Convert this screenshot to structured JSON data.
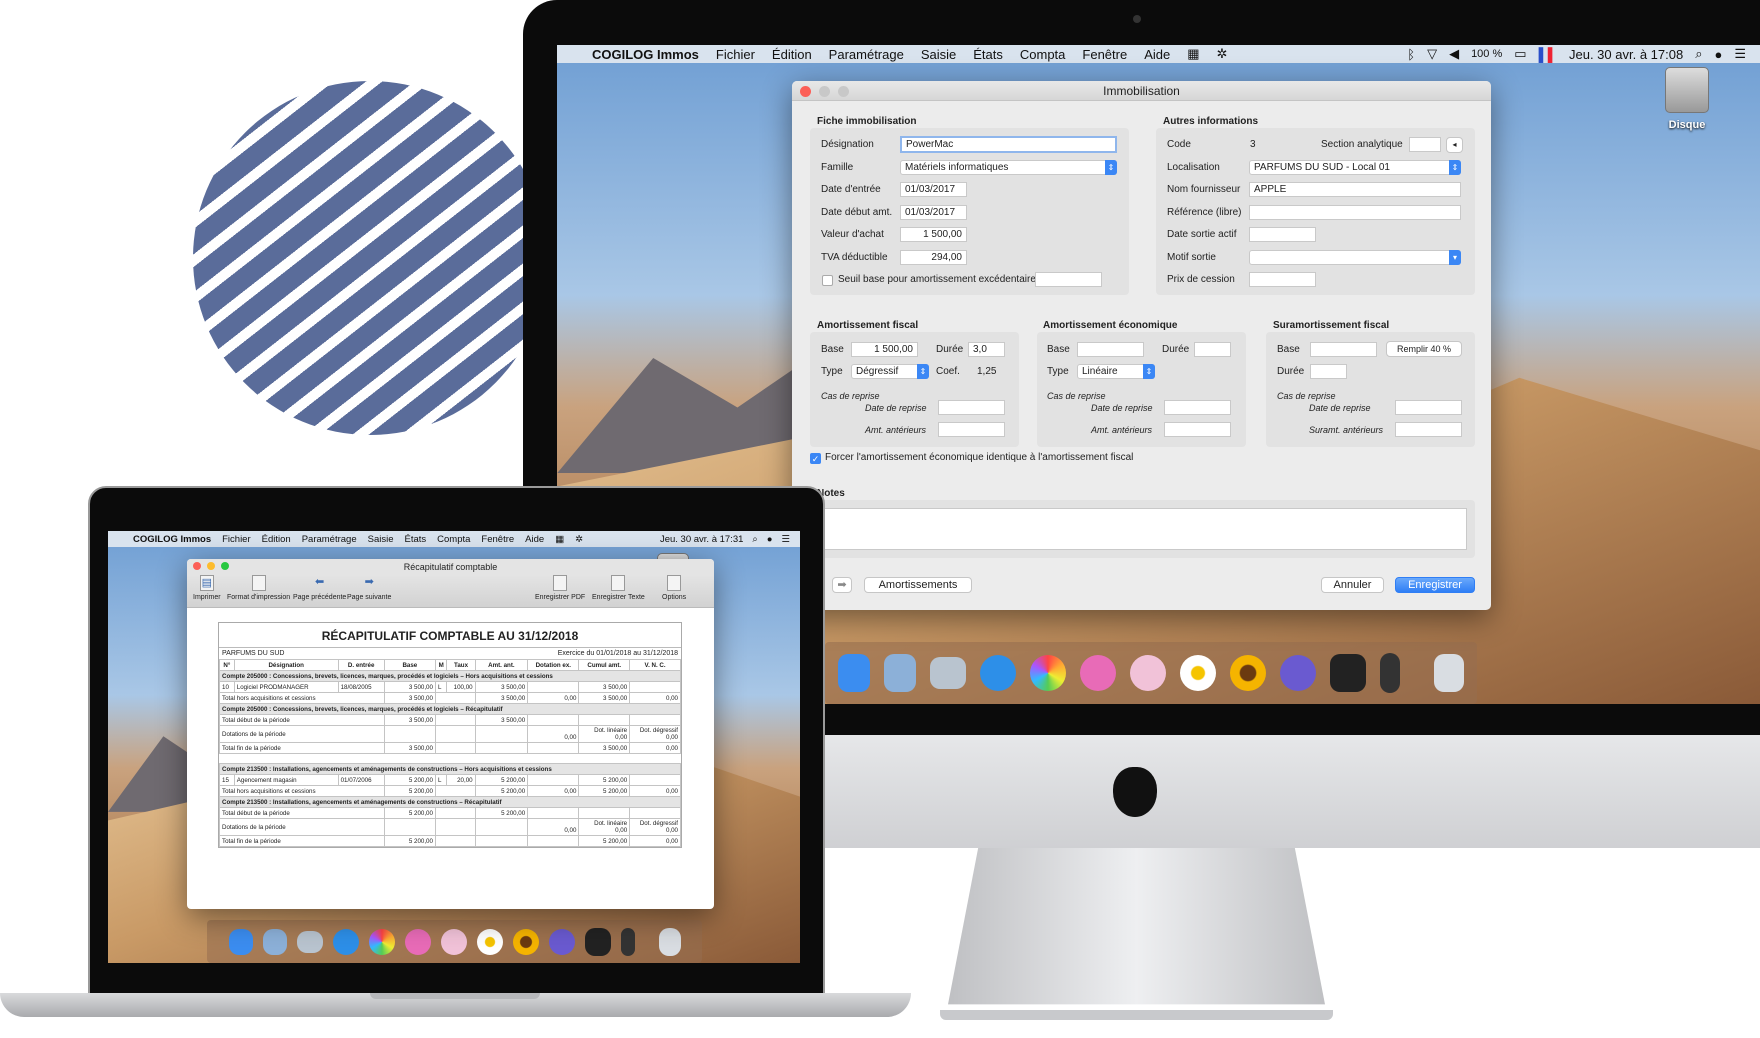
{
  "imac": {
    "menubar": {
      "app": "COGILOG Immos",
      "items": [
        "Fichier",
        "Édition",
        "Paramétrage",
        "Saisie",
        "États",
        "Compta",
        "Fenêtre",
        "Aide"
      ],
      "battery": "100 %",
      "clock": "Jeu. 30 avr. à 17:08"
    },
    "desktop_icon": "Disque",
    "window": {
      "title": "Immobilisation",
      "fiche": {
        "heading": "Fiche immobilisation",
        "designation_label": "Désignation",
        "designation": "PowerMac",
        "famille_label": "Famille",
        "famille": "Matériels informatiques",
        "date_entree_label": "Date d'entrée",
        "date_entree": "01/03/2017",
        "date_debut_label": "Date début amt.",
        "date_debut": "01/03/2017",
        "valeur_label": "Valeur d'achat",
        "valeur": "1 500,00",
        "tva_label": "TVA déductible",
        "tva": "294,00",
        "seuil_label": "Seuil base pour amortissement excédentaire",
        "seuil_checked": false
      },
      "autres": {
        "heading": "Autres informations",
        "code_label": "Code",
        "code": "3",
        "section_label": "Section analytique",
        "localisation_label": "Localisation",
        "localisation": "PARFUMS DU SUD - Local 01",
        "fournisseur_label": "Nom fournisseur",
        "fournisseur": "APPLE",
        "reference_label": "Référence (libre)",
        "date_sortie_label": "Date sortie actif",
        "motif_label": "Motif sortie",
        "prix_label": "Prix de cession"
      },
      "fiscal": {
        "heading": "Amortissement fiscal",
        "base_label": "Base",
        "base": "1 500,00",
        "duree_label": "Durée",
        "duree": "3,0",
        "type_label": "Type",
        "type": "Dégressif",
        "coef_label": "Coef.",
        "coef": "1,25",
        "cas": "Cas de reprise",
        "date_reprise": "Date de reprise",
        "amt_ant": "Amt. antérieurs"
      },
      "economique": {
        "heading": "Amortissement économique",
        "base_label": "Base",
        "duree_label": "Durée",
        "type_label": "Type",
        "type": "Linéaire",
        "cas": "Cas de reprise",
        "date_reprise": "Date de reprise",
        "amt_ant": "Amt. antérieurs"
      },
      "suramort": {
        "heading": "Suramortissement fiscal",
        "base_label": "Base",
        "remplir": "Remplir 40 %",
        "duree_label": "Durée",
        "cas": "Cas de reprise",
        "date_reprise": "Date de reprise",
        "suramt_ant": "Suramt. antérieurs"
      },
      "forcer_label": "Forcer l'amortissement économique identique à l'amortissement fiscal",
      "forcer_checked": true,
      "notes_label": "Notes",
      "amortissements": "Amortissements",
      "annuler": "Annuler",
      "enregistrer": "Enregistrer"
    }
  },
  "laptop": {
    "menubar": {
      "app": "COGILOG Immos",
      "items": [
        "Fichier",
        "Édition",
        "Paramétrage",
        "Saisie",
        "États",
        "Compta",
        "Fenêtre",
        "Aide"
      ],
      "clock": "Jeu. 30 avr. à 17:31"
    },
    "desktop_icon": "Disque",
    "window": {
      "title": "Récapitulatif comptable",
      "toolbar": [
        "Imprimer",
        "Format d'impression",
        "Page précédente",
        "Page suivante",
        "Enregistrer PDF",
        "Enregistrer Texte",
        "Options"
      ]
    },
    "report": {
      "title": "RÉCAPITULATIF COMPTABLE AU 31/12/2018",
      "company": "PARFUMS DU SUD",
      "exercice": "Exercice du 01/01/2018 au 31/12/2018",
      "columns": [
        "N°",
        "Désignation",
        "D. entrée",
        "Base",
        "M",
        "Taux",
        "Amt. ant.",
        "Dotation ex.",
        "Cumul amt.",
        "V. N. C."
      ],
      "rows": [
        {
          "kind": "section",
          "text": "Compte 205000 : Concessions, brevets, licences, marques, procédés et logiciels – Hors acquisitions et cessions"
        },
        {
          "kind": "item",
          "cells": [
            "10",
            "Logiciel PRODMANAGER",
            "18/08/2005",
            "3 500,00",
            "L",
            "100,00",
            "3 500,00",
            "",
            "3 500,00",
            ""
          ]
        },
        {
          "kind": "total",
          "label": "Total hors acquisitions et cessions",
          "cells": [
            "3 500,00",
            "",
            "3 500,00",
            "0,00",
            "3 500,00",
            "0,00"
          ]
        },
        {
          "kind": "section",
          "text": "Compte 205000 : Concessions, brevets, licences, marques, procédés et logiciels – Récapitulatif"
        },
        {
          "kind": "total",
          "label": "Total début de la période",
          "cells": [
            "3 500,00",
            "",
            "3 500,00",
            "",
            "",
            ""
          ]
        },
        {
          "kind": "total",
          "label": "Dotations de la période",
          "cells": [
            "",
            "",
            "",
            "\n0,00",
            "Dot. linéaire\n0,00",
            "Dot. dégressif\n0,00"
          ]
        },
        {
          "kind": "total",
          "label": "Total fin de la période",
          "cells": [
            "3 500,00",
            "",
            "",
            "",
            "3 500,00",
            "0,00"
          ]
        },
        {
          "kind": "gap"
        },
        {
          "kind": "section",
          "text": "Compte 213500 : Installations, agencements et aménagements de constructions – Hors acquisitions et cessions"
        },
        {
          "kind": "item",
          "cells": [
            "15",
            "Agencement magasin",
            "01/07/2006",
            "5 200,00",
            "L",
            "20,00",
            "5 200,00",
            "",
            "5 200,00",
            ""
          ]
        },
        {
          "kind": "total",
          "label": "Total hors acquisitions et cessions",
          "cells": [
            "5 200,00",
            "",
            "5 200,00",
            "0,00",
            "5 200,00",
            "0,00"
          ]
        },
        {
          "kind": "section",
          "text": "Compte 213500 : Installations, agencements et aménagements de constructions – Récapitulatif"
        },
        {
          "kind": "total",
          "label": "Total début de la période",
          "cells": [
            "5 200,00",
            "",
            "5 200,00",
            "",
            "",
            ""
          ]
        },
        {
          "kind": "total",
          "label": "Dotations de la période",
          "cells": [
            "",
            "",
            "",
            "\n0,00",
            "Dot. linéaire\n0,00",
            "Dot. dégressif\n0,00"
          ]
        },
        {
          "kind": "total",
          "label": "Total fin de la période",
          "cells": [
            "5 200,00",
            "",
            "",
            "",
            "5 200,00",
            "0,00"
          ]
        }
      ]
    }
  },
  "colors": {
    "stripes": "#5a6c9a",
    "accent": "#3b87f5"
  }
}
